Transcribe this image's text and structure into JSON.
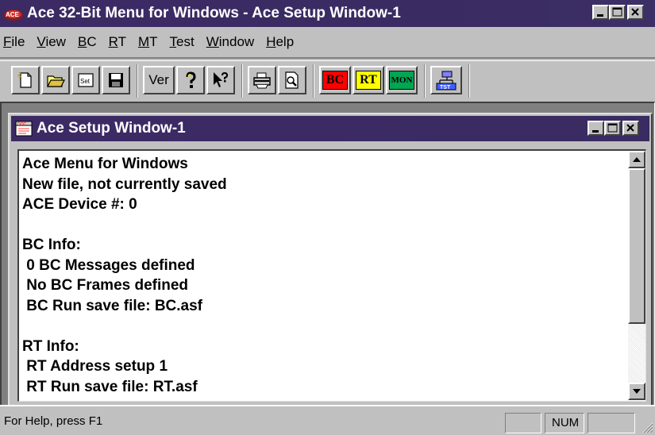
{
  "window": {
    "title": "Ace 32-Bit Menu for Windows - Ace Setup Window-1",
    "app_icon": "ace-app-icon",
    "buttons": [
      "minimize",
      "maximize",
      "close"
    ]
  },
  "menu": [
    {
      "pre": "",
      "u": "F",
      "post": "ile"
    },
    {
      "pre": "",
      "u": "V",
      "post": "iew"
    },
    {
      "pre": "",
      "u": "B",
      "post": "C"
    },
    {
      "pre": "",
      "u": "R",
      "post": "T"
    },
    {
      "pre": "",
      "u": "M",
      "post": "T"
    },
    {
      "pre": "",
      "u": "T",
      "post": "est"
    },
    {
      "pre": "",
      "u": "W",
      "post": "indow"
    },
    {
      "pre": "",
      "u": "H",
      "post": "elp"
    }
  ],
  "toolbar": {
    "ver_label": "Ver",
    "bc_label": "BC",
    "rt_label": "RT",
    "mon_label": "MON",
    "colors": {
      "bc": "#ff0000",
      "rt": "#ffff00",
      "mon": "#00a651"
    }
  },
  "child": {
    "title": "Ace Setup Window-1",
    "lines": [
      "Ace Menu for Windows",
      "New file, not currently saved",
      "ACE Device #: 0",
      "",
      "BC Info:",
      " 0 BC Messages defined",
      " No BC Frames defined",
      " BC Run save file: BC.asf",
      "",
      "RT Info:",
      " RT Address setup 1",
      " RT Run save file: RT.asf"
    ]
  },
  "status": {
    "help_text": "For Help, press F1",
    "panel_1": "",
    "panel_num": "NUM",
    "panel_3": ""
  },
  "colors": {
    "titlebar": "#3c2a64",
    "face": "#c0c0c0",
    "workspace": "#808080"
  }
}
